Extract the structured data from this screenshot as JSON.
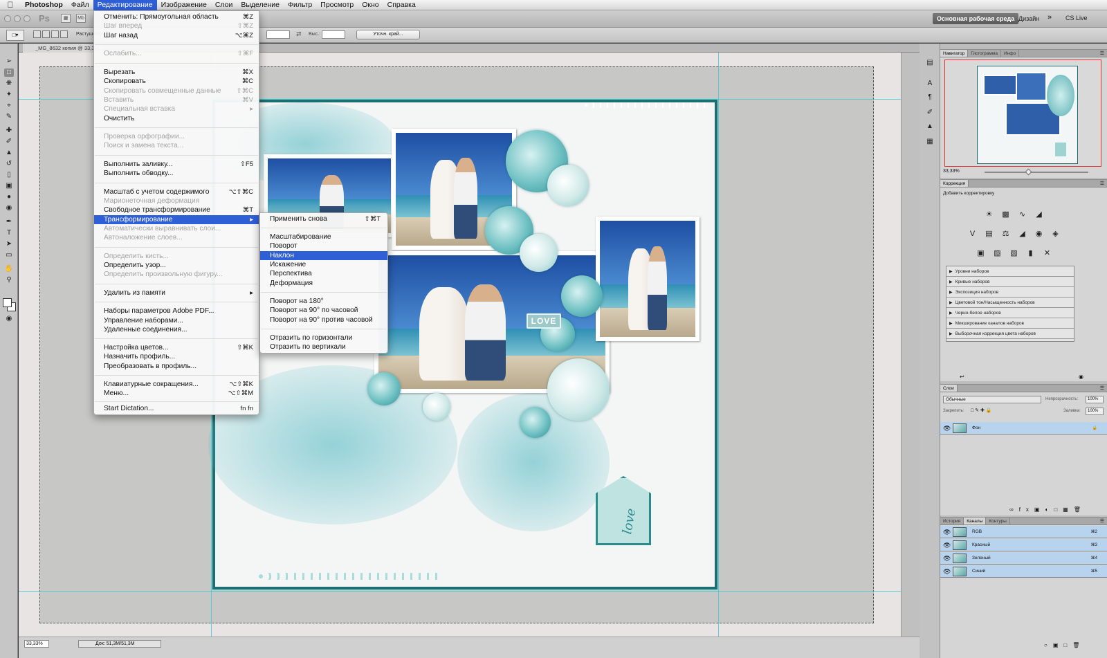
{
  "menubar": {
    "app": "Photoshop",
    "items": [
      "Файл",
      "Редактирование",
      "Изображение",
      "Слои",
      "Выделение",
      "Фильтр",
      "Просмотр",
      "Окно",
      "Справка"
    ],
    "active_index": 1
  },
  "appbar": {
    "ps_logo": "Ps",
    "mb_label": "Mb",
    "workspace": "Основная рабочая среда",
    "design": "Дизайн",
    "cslive": "CS Live"
  },
  "options": {
    "feather_label": "Растушевка:",
    "height_label": "Выс.:",
    "refine_edge": "Уточн. край..."
  },
  "document": {
    "tab_title": "_MG_8632 копия @ 33,3%",
    "zoom": "33,33%",
    "doc_size": "Док: 51,3M/51,3M",
    "love_plate": "LOVE",
    "tag_text": "love"
  },
  "edit_menu": {
    "items": [
      {
        "label": "Отменить: Прямоугольная область",
        "shortcut": "⌘Z",
        "disabled": false
      },
      {
        "label": "Шаг вперед",
        "shortcut": "⇧⌘Z",
        "disabled": true
      },
      {
        "label": "Шаг назад",
        "shortcut": "⌥⌘Z",
        "disabled": false
      },
      {
        "label": "Ослабить...",
        "shortcut": "⇧⌘F",
        "disabled": true
      },
      {
        "label": "Вырезать",
        "shortcut": "⌘X",
        "disabled": false
      },
      {
        "label": "Скопировать",
        "shortcut": "⌘C",
        "disabled": false
      },
      {
        "label": "Скопировать совмещенные данные",
        "shortcut": "⇧⌘C",
        "disabled": true
      },
      {
        "label": "Вставить",
        "shortcut": "⌘V",
        "disabled": true
      },
      {
        "label": "Специальная вставка",
        "shortcut": "▸",
        "disabled": true
      },
      {
        "label": "Очистить",
        "shortcut": "",
        "disabled": false
      },
      {
        "label": "Проверка орфографии...",
        "shortcut": "",
        "disabled": true
      },
      {
        "label": "Поиск и замена текста...",
        "shortcut": "",
        "disabled": true
      },
      {
        "label": "Выполнить заливку...",
        "shortcut": "⇧F5",
        "disabled": false
      },
      {
        "label": "Выполнить обводку...",
        "shortcut": "",
        "disabled": false
      },
      {
        "label": "Масштаб с учетом содержимого",
        "shortcut": "⌥⇧⌘C",
        "disabled": false
      },
      {
        "label": "Марионеточная деформация",
        "shortcut": "",
        "disabled": true
      },
      {
        "label": "Свободное трансформирование",
        "shortcut": "⌘T",
        "disabled": false
      },
      {
        "label": "Трансформирование",
        "shortcut": "▸",
        "disabled": false,
        "highlighted": true
      },
      {
        "label": "Автоматически выравнивать слои...",
        "shortcut": "",
        "disabled": true
      },
      {
        "label": "Автоналожение слоев...",
        "shortcut": "",
        "disabled": true
      },
      {
        "label": "Определить кисть...",
        "shortcut": "",
        "disabled": true
      },
      {
        "label": "Определить узор...",
        "shortcut": "",
        "disabled": false
      },
      {
        "label": "Определить произвольную фигуру...",
        "shortcut": "",
        "disabled": true
      },
      {
        "label": "Удалить из памяти",
        "shortcut": "▸",
        "disabled": false
      },
      {
        "label": "Наборы параметров Adobe PDF...",
        "shortcut": "",
        "disabled": false
      },
      {
        "label": "Управление наборами...",
        "shortcut": "",
        "disabled": false
      },
      {
        "label": "Удаленные соединения...",
        "shortcut": "",
        "disabled": false
      },
      {
        "label": "Настройка цветов...",
        "shortcut": "⇧⌘K",
        "disabled": false
      },
      {
        "label": "Назначить профиль...",
        "shortcut": "",
        "disabled": false
      },
      {
        "label": "Преобразовать в профиль...",
        "shortcut": "",
        "disabled": false
      },
      {
        "label": "Клавиатурные сокращения...",
        "shortcut": "⌥⇧⌘K",
        "disabled": false
      },
      {
        "label": "Меню...",
        "shortcut": "⌥⇧⌘M",
        "disabled": false
      },
      {
        "label": "Start Dictation...",
        "shortcut": "fn fn",
        "disabled": false
      }
    ]
  },
  "transform_submenu": {
    "items": [
      {
        "label": "Применить снова",
        "shortcut": "⇧⌘T"
      },
      {
        "label": "Масштабирование",
        "shortcut": ""
      },
      {
        "label": "Поворот",
        "shortcut": ""
      },
      {
        "label": "Наклон",
        "shortcut": "",
        "highlighted": true
      },
      {
        "label": "Искажение",
        "shortcut": ""
      },
      {
        "label": "Перспектива",
        "shortcut": ""
      },
      {
        "label": "Деформация",
        "shortcut": ""
      },
      {
        "label": "Поворот на 180°",
        "shortcut": ""
      },
      {
        "label": "Поворот на 90° по часовой",
        "shortcut": ""
      },
      {
        "label": "Поворот на 90° против часовой",
        "shortcut": ""
      },
      {
        "label": "Отразить по горизонтали",
        "shortcut": ""
      },
      {
        "label": "Отразить по вертикали",
        "shortcut": ""
      }
    ]
  },
  "panels": {
    "nav_tabs": [
      "Навигатор",
      "Гистограмма",
      "Инфо"
    ],
    "nav_zoom": "33,33%",
    "correction_title": "Коррекция",
    "correction_subtitle": "Добавить корректировку",
    "presets": [
      "Уровни наборов",
      "Кривые наборов",
      "Экспозиция наборов",
      "Цветовой тон/Насыщенность наборов",
      "Черно-белое наборов",
      "Микширование каналов наборов",
      "Выборочная коррекция цвета наборов"
    ],
    "layers_tab": "Слои",
    "blend_mode": "Обычные",
    "opacity_label": "Непрозрачность:",
    "opacity_value": "100%",
    "lock_label": "Закрепить:",
    "fill_label": "Заливка:",
    "fill_value": "100%",
    "layer_name": "Фон",
    "channel_tabs": [
      "История",
      "Каналы",
      "Контуры"
    ],
    "channels": [
      {
        "name": "RGB",
        "key": "⌘2"
      },
      {
        "name": "Красный",
        "key": "⌘3"
      },
      {
        "name": "Зеленый",
        "key": "⌘4"
      },
      {
        "name": "Синий",
        "key": "⌘5"
      }
    ]
  },
  "colors": {
    "accent": "#2f5fd6",
    "guide": "#3ec9cf",
    "frame": "#1c6e72"
  }
}
